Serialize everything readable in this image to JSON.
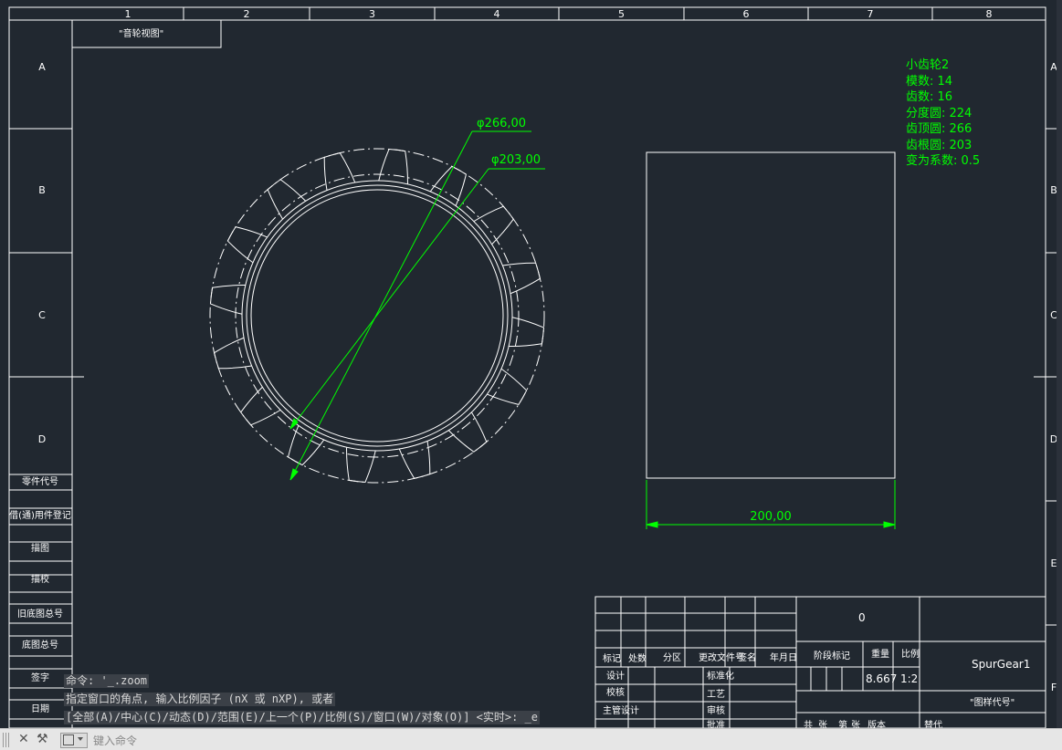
{
  "drawing": {
    "col_numbers": [
      "1",
      "2",
      "3",
      "4",
      "5",
      "6",
      "7",
      "8"
    ],
    "row_letters_left": [
      "A",
      "B",
      "C",
      "D"
    ],
    "row_letters_right": [
      "A",
      "B",
      "C",
      "D",
      "E",
      "F"
    ],
    "corner_label": "\"音轮视图\"",
    "left_strip_labels": [
      "零件代号",
      "借(通)用件登记",
      "描图",
      "描校",
      "旧底图总号",
      "底图总号",
      "签字",
      "日期"
    ],
    "gear_info": {
      "title": "小齿轮2",
      "lines": [
        "模数: 14",
        "齿数: 16",
        "分度圆: 224",
        "齿顶圆: 266",
        "齿根圆: 203",
        "变为系数: 0.5"
      ]
    },
    "dimensions": {
      "outer_dia": "φ266,00",
      "root_dia": "φ203,00",
      "width": "200,00"
    },
    "gear": {
      "teeth": 16
    },
    "title_block": {
      "row_labels": [
        "标记",
        "处数",
        "分区",
        "更改文件号",
        "签名",
        "年月日"
      ],
      "roles_left": [
        "设计",
        "校核",
        "主管设计"
      ],
      "roles_mid": [
        "标准化",
        "工艺",
        "审核",
        "批准"
      ],
      "stage_label": "阶段标记",
      "weight_label": "重量",
      "scale_label": "比例",
      "weight_value": "8.667",
      "scale_value": "1:2",
      "material_value": "0",
      "part_name": "SpurGear1",
      "drawing_code": "\"图样代号\"",
      "bottom_labels": [
        "共",
        "张",
        "第",
        "张",
        "版本",
        "替代"
      ]
    }
  },
  "command_history": [
    "命令: '_.zoom",
    "指定窗口的角点, 输入比例因子 (nX 或 nXP), 或者",
    "[全部(A)/中心(C)/动态(D)/范围(E)/上一个(P)/比例(S)/窗口(W)/对象(O)] <实时>: _e"
  ],
  "command_line": {
    "placeholder": "键入命令"
  },
  "colors": {
    "background": "#212830",
    "lines": "#ffffff",
    "annotation": "#00ff00"
  }
}
